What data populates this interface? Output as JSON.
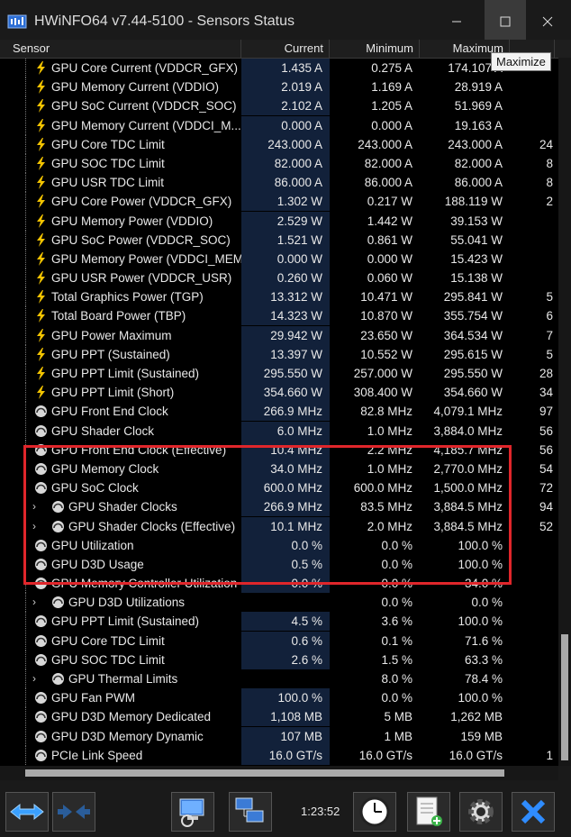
{
  "window": {
    "title": "HWiNFO64 v7.44-5100 - Sensors Status",
    "tooltip": "Maximize",
    "app_icon": "hwinfo-icon",
    "controls": [
      "minimize-icon",
      "maximize-icon",
      "close-icon"
    ]
  },
  "table": {
    "columns": [
      "Sensor",
      "Current",
      "Minimum",
      "Maximum",
      ""
    ],
    "rows": [
      {
        "icon": "bolt",
        "indent": 0,
        "label": "GPU Core Current (VDDCR_GFX)",
        "current": "1.435 A",
        "minimum": "0.275 A",
        "maximum": "174.107 A",
        "average": ""
      },
      {
        "icon": "bolt",
        "indent": 0,
        "label": "GPU Memory Current (VDDIO)",
        "current": "2.019 A",
        "minimum": "1.169 A",
        "maximum": "28.919 A",
        "average": ""
      },
      {
        "icon": "bolt",
        "indent": 0,
        "label": "GPU SoC Current (VDDCR_SOC)",
        "current": "2.102 A",
        "minimum": "1.205 A",
        "maximum": "51.969 A",
        "average": ""
      },
      {
        "icon": "bolt",
        "indent": 0,
        "label": "GPU Memory Current (VDDCI_M...",
        "current": "0.000 A",
        "minimum": "0.000 A",
        "maximum": "19.163 A",
        "average": ""
      },
      {
        "icon": "bolt",
        "indent": 0,
        "label": "GPU Core TDC Limit",
        "current": "243.000 A",
        "minimum": "243.000 A",
        "maximum": "243.000 A",
        "average": "24"
      },
      {
        "icon": "bolt",
        "indent": 0,
        "label": "GPU SOC TDC Limit",
        "current": "82.000 A",
        "minimum": "82.000 A",
        "maximum": "82.000 A",
        "average": "8"
      },
      {
        "icon": "bolt",
        "indent": 0,
        "label": "GPU USR TDC Limit",
        "current": "86.000 A",
        "minimum": "86.000 A",
        "maximum": "86.000 A",
        "average": "8"
      },
      {
        "icon": "bolt",
        "indent": 0,
        "label": "GPU Core Power (VDDCR_GFX)",
        "current": "1.302 W",
        "minimum": "0.217 W",
        "maximum": "188.119 W",
        "average": "2"
      },
      {
        "icon": "bolt",
        "indent": 0,
        "label": "GPU Memory Power (VDDIO)",
        "current": "2.529 W",
        "minimum": "1.442 W",
        "maximum": "39.153 W",
        "average": ""
      },
      {
        "icon": "bolt",
        "indent": 0,
        "label": "GPU SoC Power (VDDCR_SOC)",
        "current": "1.521 W",
        "minimum": "0.861 W",
        "maximum": "55.041 W",
        "average": ""
      },
      {
        "icon": "bolt",
        "indent": 0,
        "label": "GPU Memory Power (VDDCI_MEM)",
        "current": "0.000 W",
        "minimum": "0.000 W",
        "maximum": "15.423 W",
        "average": ""
      },
      {
        "icon": "bolt",
        "indent": 0,
        "label": "GPU USR Power (VDDCR_USR)",
        "current": "0.260 W",
        "minimum": "0.060 W",
        "maximum": "15.138 W",
        "average": ""
      },
      {
        "icon": "bolt",
        "indent": 0,
        "label": "Total Graphics Power (TGP)",
        "current": "13.312 W",
        "minimum": "10.471 W",
        "maximum": "295.841 W",
        "average": "5"
      },
      {
        "icon": "bolt",
        "indent": 0,
        "label": "Total Board Power (TBP)",
        "current": "14.323 W",
        "minimum": "10.870 W",
        "maximum": "355.754 W",
        "average": "6"
      },
      {
        "icon": "bolt",
        "indent": 0,
        "label": "GPU Power Maximum",
        "current": "29.942 W",
        "minimum": "23.650 W",
        "maximum": "364.534 W",
        "average": "7"
      },
      {
        "icon": "bolt",
        "indent": 0,
        "label": "GPU PPT (Sustained)",
        "current": "13.397 W",
        "minimum": "10.552 W",
        "maximum": "295.615 W",
        "average": "5"
      },
      {
        "icon": "bolt",
        "indent": 0,
        "label": "GPU PPT Limit (Sustained)",
        "current": "295.550 W",
        "minimum": "257.000 W",
        "maximum": "295.550 W",
        "average": "28"
      },
      {
        "icon": "bolt",
        "indent": 0,
        "label": "GPU PPT Limit (Short)",
        "current": "354.660 W",
        "minimum": "308.400 W",
        "maximum": "354.660 W",
        "average": "34"
      },
      {
        "icon": "gauge",
        "indent": 0,
        "label": "GPU Front End Clock",
        "current": "266.9 MHz",
        "minimum": "82.8 MHz",
        "maximum": "4,079.1 MHz",
        "average": "97"
      },
      {
        "icon": "gauge",
        "indent": 0,
        "label": "GPU Shader Clock",
        "current": "6.0 MHz",
        "minimum": "1.0 MHz",
        "maximum": "3,884.0 MHz",
        "average": "56"
      },
      {
        "icon": "gauge",
        "indent": 0,
        "label": "GPU Front End Clock (Effective)",
        "current": "10.4 MHz",
        "minimum": "2.2 MHz",
        "maximum": "4,185.7 MHz",
        "average": "56"
      },
      {
        "icon": "gauge",
        "indent": 0,
        "label": "GPU Memory Clock",
        "current": "34.0 MHz",
        "minimum": "1.0 MHz",
        "maximum": "2,770.0 MHz",
        "average": "54"
      },
      {
        "icon": "gauge",
        "indent": 0,
        "label": "GPU SoC Clock",
        "current": "600.0 MHz",
        "minimum": "600.0 MHz",
        "maximum": "1,500.0 MHz",
        "average": "72"
      },
      {
        "icon": "gauge",
        "indent": 1,
        "label": "GPU Shader Clocks",
        "current": "266.9 MHz",
        "minimum": "83.5 MHz",
        "maximum": "3,884.5 MHz",
        "average": "94"
      },
      {
        "icon": "gauge",
        "indent": 1,
        "label": "GPU Shader Clocks (Effective)",
        "current": "10.1 MHz",
        "minimum": "2.0 MHz",
        "maximum": "3,884.5 MHz",
        "average": "52"
      },
      {
        "icon": "gauge",
        "indent": 0,
        "label": "GPU Utilization",
        "current": "0.0 %",
        "minimum": "0.0 %",
        "maximum": "100.0 %",
        "average": ""
      },
      {
        "icon": "gauge",
        "indent": 0,
        "label": "GPU D3D Usage",
        "current": "0.5 %",
        "minimum": "0.0 %",
        "maximum": "100.0 %",
        "average": ""
      },
      {
        "icon": "gauge",
        "indent": 0,
        "label": "GPU Memory Controller Utilization",
        "current": "0.0 %",
        "minimum": "0.0 %",
        "maximum": "34.0 %",
        "average": ""
      },
      {
        "icon": "gauge",
        "indent": 1,
        "label": "GPU D3D Utilizations",
        "current": "",
        "minimum": "0.0 %",
        "maximum": "0.0 %",
        "average": ""
      },
      {
        "icon": "gauge",
        "indent": 0,
        "label": "GPU PPT Limit (Sustained)",
        "current": "4.5 %",
        "minimum": "3.6 %",
        "maximum": "100.0 %",
        "average": ""
      },
      {
        "icon": "gauge",
        "indent": 0,
        "label": "GPU Core TDC Limit",
        "current": "0.6 %",
        "minimum": "0.1 %",
        "maximum": "71.6 %",
        "average": ""
      },
      {
        "icon": "gauge",
        "indent": 0,
        "label": "GPU SOC TDC Limit",
        "current": "2.6 %",
        "minimum": "1.5 %",
        "maximum": "63.3 %",
        "average": ""
      },
      {
        "icon": "gauge",
        "indent": 1,
        "label": "GPU Thermal Limits",
        "current": "",
        "minimum": "8.0 %",
        "maximum": "78.4 %",
        "average": ""
      },
      {
        "icon": "gauge",
        "indent": 0,
        "label": "GPU Fan PWM",
        "current": "100.0 %",
        "minimum": "0.0 %",
        "maximum": "100.0 %",
        "average": ""
      },
      {
        "icon": "gauge",
        "indent": 0,
        "label": "GPU D3D Memory Dedicated",
        "current": "1,108 MB",
        "minimum": "5 MB",
        "maximum": "1,262 MB",
        "average": ""
      },
      {
        "icon": "gauge",
        "indent": 0,
        "label": "GPU D3D Memory Dynamic",
        "current": "107 MB",
        "minimum": "1 MB",
        "maximum": "159 MB",
        "average": ""
      },
      {
        "icon": "gauge",
        "indent": 0,
        "label": "PCIe Link Speed",
        "current": "16.0 GT/s",
        "minimum": "16.0 GT/s",
        "maximum": "16.0 GT/s",
        "average": "1"
      }
    ]
  },
  "toolbar": {
    "buttons": [
      "arrows-lr-icon",
      "arrows-collapse-icon",
      "computer-icon",
      "network-icon",
      "clock-icon",
      "report-icon",
      "settings-gear-icon",
      "close-x-icon"
    ],
    "elapsed": "1:23:52"
  },
  "colors": {
    "accent": "#e0262b",
    "bolt": "#f2c300",
    "current_bg": "#12213a"
  }
}
